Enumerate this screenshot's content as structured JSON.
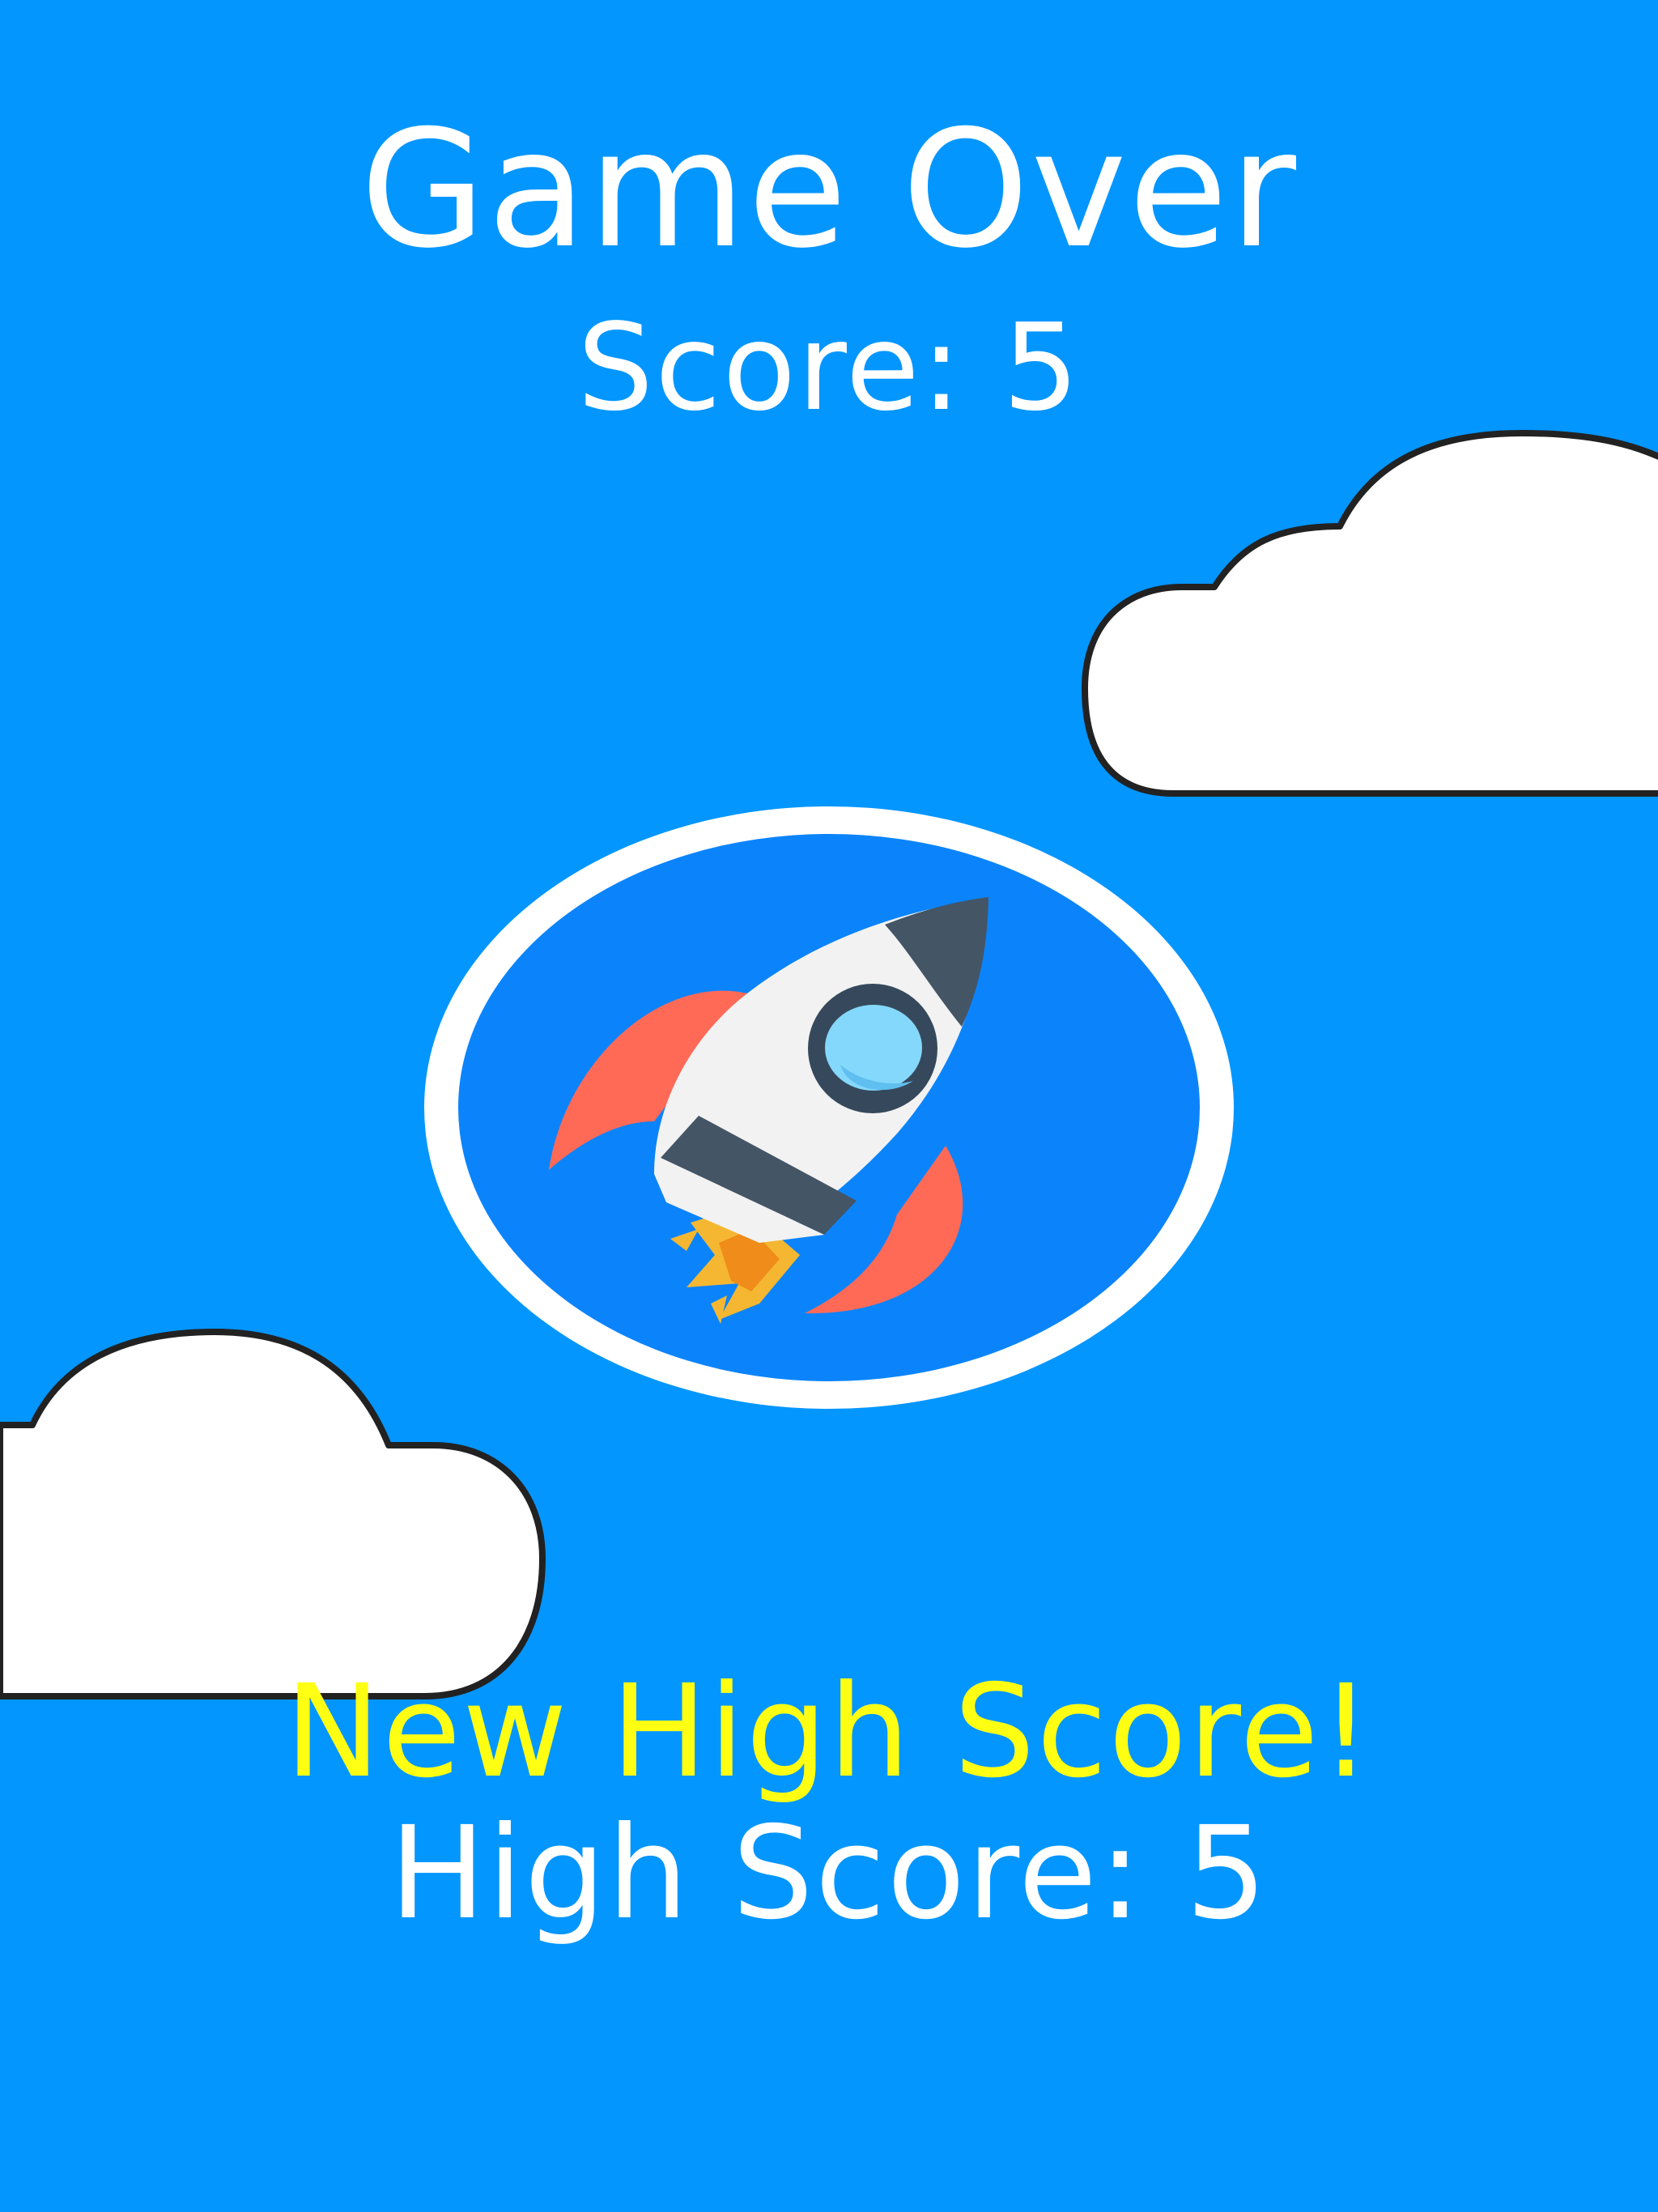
{
  "game_over": {
    "title": "Game Over",
    "score_text": "Score: 5",
    "new_high_score_text": "New High Score!",
    "high_score_text": "High Score: 5"
  },
  "icons": {
    "clouds": [
      "cloud-icon",
      "cloud-icon"
    ],
    "center_emblem": "rocket-icon"
  },
  "colors": {
    "background": "#0396ff",
    "text_primary": "#ffffff",
    "text_highlight": "#ffff14",
    "emblem_inner": "#0b84fb",
    "cloud_fill": "#ffffff",
    "cloud_outline": "#222222",
    "rocket_body": "#f2f2f2",
    "rocket_dark": "#445566",
    "rocket_fin": "#ff6a57",
    "rocket_flame": "#f5b731",
    "rocket_window": "#84d8fb"
  }
}
